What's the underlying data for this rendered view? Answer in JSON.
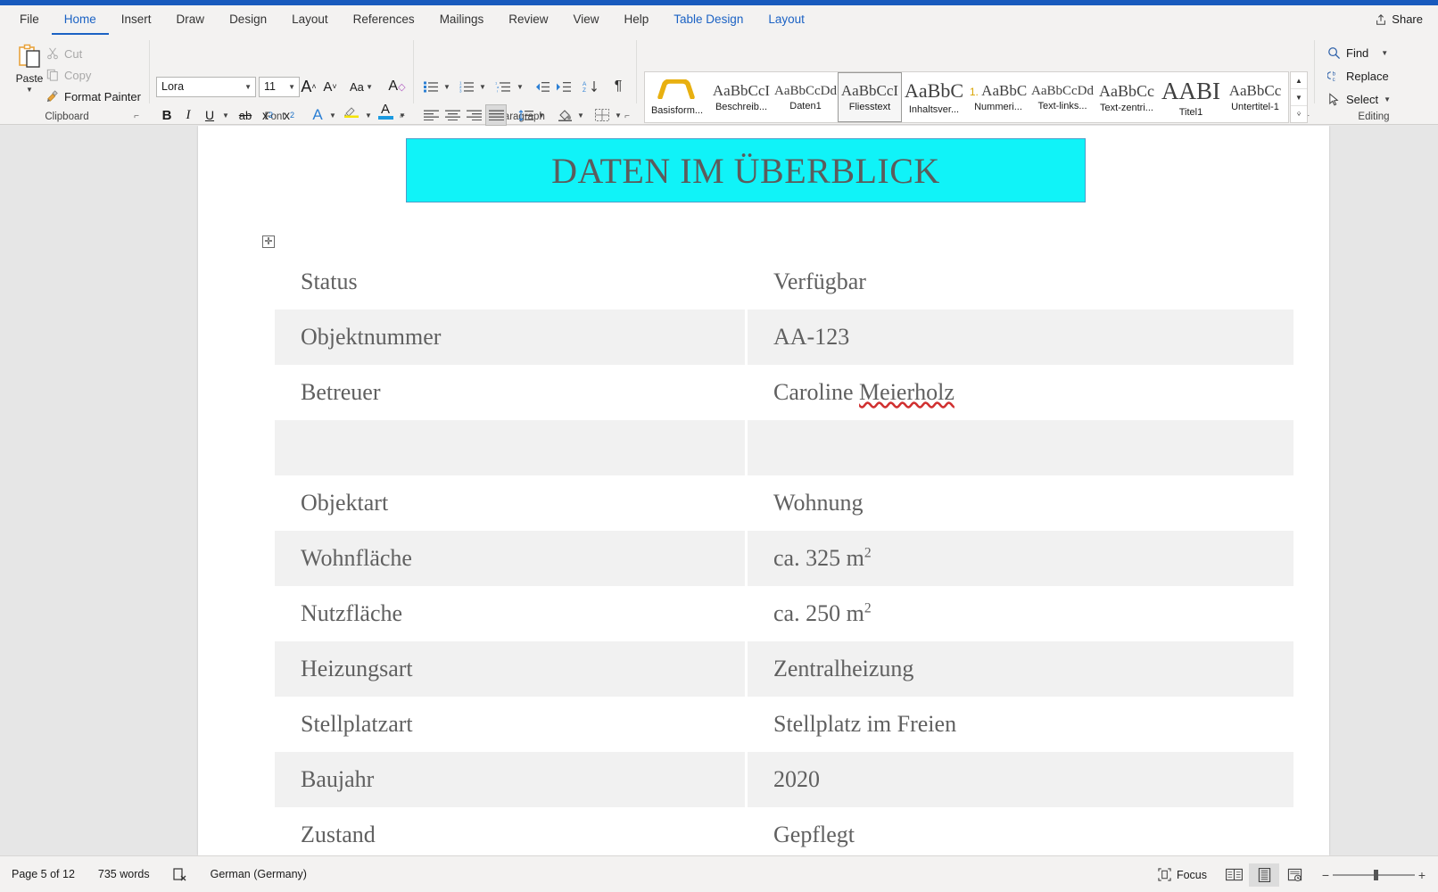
{
  "window": {
    "share_label": "Share",
    "share_icon": "share-icon"
  },
  "tabs": [
    {
      "label": "File",
      "state": "normal"
    },
    {
      "label": "Home",
      "state": "active"
    },
    {
      "label": "Insert",
      "state": "normal"
    },
    {
      "label": "Draw",
      "state": "normal"
    },
    {
      "label": "Design",
      "state": "normal"
    },
    {
      "label": "Layout",
      "state": "normal"
    },
    {
      "label": "References",
      "state": "normal"
    },
    {
      "label": "Mailings",
      "state": "normal"
    },
    {
      "label": "Review",
      "state": "normal"
    },
    {
      "label": "View",
      "state": "normal"
    },
    {
      "label": "Help",
      "state": "normal"
    },
    {
      "label": "Table Design",
      "state": "contextual"
    },
    {
      "label": "Layout",
      "state": "contextual"
    }
  ],
  "ribbon": {
    "clipboard": {
      "group_label": "Clipboard",
      "paste_label": "Paste",
      "cut_label": "Cut",
      "copy_label": "Copy",
      "format_painter_label": "Format Painter"
    },
    "font": {
      "group_label": "Font",
      "font_name": "Lora",
      "font_size": "11",
      "grow_font": "A",
      "shrink_font": "A",
      "change_case": "Aa",
      "clear_formatting": "A",
      "bold": "B",
      "italic": "I",
      "underline": "U",
      "strikethrough": "ab",
      "subscript": "x",
      "subscript_sub": "2",
      "superscript": "x",
      "superscript_sup": "2",
      "text_effects": "A",
      "highlight": "A",
      "font_color": "A"
    },
    "paragraph": {
      "group_label": "Paragraph"
    },
    "styles": {
      "group_label": "Styles",
      "items": [
        {
          "preview": "⌒",
          "name": "Basisform...",
          "selected": false,
          "kind": "shape"
        },
        {
          "preview": "AaBbCcI",
          "name": "Beschreib...",
          "selected": false,
          "size": 17
        },
        {
          "preview": "AaBbCcDd",
          "name": "Daten1",
          "selected": false,
          "size": 15
        },
        {
          "preview": "AaBbCcI",
          "name": "Fliesstext",
          "selected": true,
          "size": 17
        },
        {
          "preview": "AaBbC",
          "name": "Inhaltsver...",
          "selected": false,
          "size": 22
        },
        {
          "preview": "AaBbC",
          "name": "Nummeri...",
          "selected": false,
          "size": 17,
          "numprefix": "1."
        },
        {
          "preview": "AaBbCcDd",
          "name": "Text-links...",
          "selected": false,
          "size": 15
        },
        {
          "preview": "AaBbCc",
          "name": "Text-zentri...",
          "selected": false,
          "size": 18
        },
        {
          "preview": "AABI",
          "name": "Titel1",
          "selected": false,
          "size": 27
        },
        {
          "preview": "AaBbCc",
          "name": "Untertitel-1",
          "selected": false,
          "size": 17
        }
      ]
    },
    "editing": {
      "group_label": "Editing",
      "find_label": "Find",
      "replace_label": "Replace",
      "select_label": "Select"
    }
  },
  "document": {
    "heading": "DATEN IM ÜBERBLICK",
    "heading_highlight_color": "#10f3f8",
    "table": {
      "rows": [
        {
          "label": "Status",
          "value": "Verfügbar",
          "shaded": false
        },
        {
          "label": "Objektnummer",
          "value": "AA-123",
          "shaded": true
        },
        {
          "label": "Betreuer",
          "value": "Caroline Meierholz",
          "shaded": false,
          "misspelled": "Meierholz"
        },
        {
          "label": "",
          "value": "",
          "shaded": true
        },
        {
          "label": "Objektart",
          "value": "Wohnung",
          "shaded": false
        },
        {
          "label": "Wohnfläche",
          "value": "ca. 325 m²",
          "shaded": true
        },
        {
          "label": "Nutzfläche",
          "value": "ca. 250 m²",
          "shaded": false
        },
        {
          "label": "Heizungsart",
          "value": "Zentralheizung",
          "shaded": true
        },
        {
          "label": "Stellplatzart",
          "value": "Stellplatz im Freien",
          "shaded": false
        },
        {
          "label": "Baujahr",
          "value": "2020",
          "shaded": true
        },
        {
          "label": "Zustand",
          "value": "Gepflegt",
          "shaded": false
        }
      ]
    }
  },
  "statusbar": {
    "page_info": "Page 5 of 12",
    "word_count": "735 words",
    "proofing_icon": "proofing-errors-icon",
    "language": "German (Germany)",
    "focus_label": "Focus",
    "read_mode_icon": "read-mode-icon",
    "print_layout_icon": "print-layout-icon",
    "web_layout_icon": "web-layout-icon",
    "zoom_minus": "−",
    "zoom_plus": "+"
  }
}
